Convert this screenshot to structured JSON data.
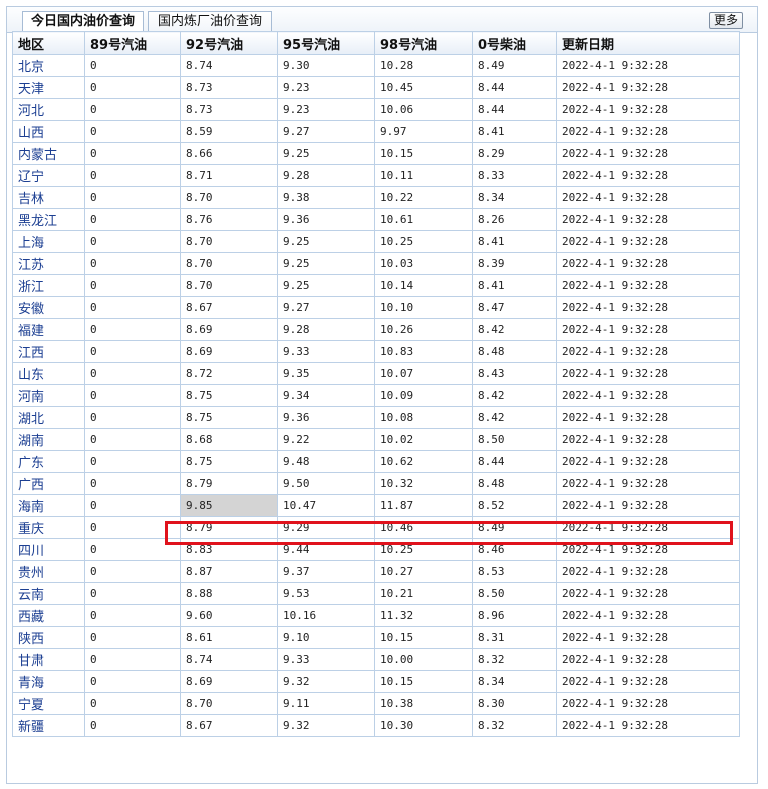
{
  "tabs": [
    {
      "label": "今日国内油价查询",
      "active": true
    },
    {
      "label": "国内炼厂油价查询",
      "active": false
    }
  ],
  "more_label": "更多",
  "columns": [
    "地区",
    "89号汽油",
    "92号汽油",
    "95号汽油",
    "98号汽油",
    "0号柴油",
    "更新日期"
  ],
  "rows": [
    {
      "region": "北京",
      "g89": "0",
      "g92": "8.74",
      "g95": "9.30",
      "g98": "10.28",
      "d0": "8.49",
      "date": "2022-4-1 9:32:28"
    },
    {
      "region": "天津",
      "g89": "0",
      "g92": "8.73",
      "g95": "9.23",
      "g98": "10.45",
      "d0": "8.44",
      "date": "2022-4-1 9:32:28"
    },
    {
      "region": "河北",
      "g89": "0",
      "g92": "8.73",
      "g95": "9.23",
      "g98": "10.06",
      "d0": "8.44",
      "date": "2022-4-1 9:32:28"
    },
    {
      "region": "山西",
      "g89": "0",
      "g92": "8.59",
      "g95": "9.27",
      "g98": "9.97",
      "d0": "8.41",
      "date": "2022-4-1 9:32:28"
    },
    {
      "region": "内蒙古",
      "g89": "0",
      "g92": "8.66",
      "g95": "9.25",
      "g98": "10.15",
      "d0": "8.29",
      "date": "2022-4-1 9:32:28"
    },
    {
      "region": "辽宁",
      "g89": "0",
      "g92": "8.71",
      "g95": "9.28",
      "g98": "10.11",
      "d0": "8.33",
      "date": "2022-4-1 9:32:28"
    },
    {
      "region": "吉林",
      "g89": "0",
      "g92": "8.70",
      "g95": "9.38",
      "g98": "10.22",
      "d0": "8.34",
      "date": "2022-4-1 9:32:28"
    },
    {
      "region": "黑龙江",
      "g89": "0",
      "g92": "8.76",
      "g95": "9.36",
      "g98": "10.61",
      "d0": "8.26",
      "date": "2022-4-1 9:32:28"
    },
    {
      "region": "上海",
      "g89": "0",
      "g92": "8.70",
      "g95": "9.25",
      "g98": "10.25",
      "d0": "8.41",
      "date": "2022-4-1 9:32:28"
    },
    {
      "region": "江苏",
      "g89": "0",
      "g92": "8.70",
      "g95": "9.25",
      "g98": "10.03",
      "d0": "8.39",
      "date": "2022-4-1 9:32:28"
    },
    {
      "region": "浙江",
      "g89": "0",
      "g92": "8.70",
      "g95": "9.25",
      "g98": "10.14",
      "d0": "8.41",
      "date": "2022-4-1 9:32:28"
    },
    {
      "region": "安徽",
      "g89": "0",
      "g92": "8.67",
      "g95": "9.27",
      "g98": "10.10",
      "d0": "8.47",
      "date": "2022-4-1 9:32:28"
    },
    {
      "region": "福建",
      "g89": "0",
      "g92": "8.69",
      "g95": "9.28",
      "g98": "10.26",
      "d0": "8.42",
      "date": "2022-4-1 9:32:28"
    },
    {
      "region": "江西",
      "g89": "0",
      "g92": "8.69",
      "g95": "9.33",
      "g98": "10.83",
      "d0": "8.48",
      "date": "2022-4-1 9:32:28"
    },
    {
      "region": "山东",
      "g89": "0",
      "g92": "8.72",
      "g95": "9.35",
      "g98": "10.07",
      "d0": "8.43",
      "date": "2022-4-1 9:32:28"
    },
    {
      "region": "河南",
      "g89": "0",
      "g92": "8.75",
      "g95": "9.34",
      "g98": "10.09",
      "d0": "8.42",
      "date": "2022-4-1 9:32:28"
    },
    {
      "region": "湖北",
      "g89": "0",
      "g92": "8.75",
      "g95": "9.36",
      "g98": "10.08",
      "d0": "8.42",
      "date": "2022-4-1 9:32:28"
    },
    {
      "region": "湖南",
      "g89": "0",
      "g92": "8.68",
      "g95": "9.22",
      "g98": "10.02",
      "d0": "8.50",
      "date": "2022-4-1 9:32:28"
    },
    {
      "region": "广东",
      "g89": "0",
      "g92": "8.75",
      "g95": "9.48",
      "g98": "10.62",
      "d0": "8.44",
      "date": "2022-4-1 9:32:28"
    },
    {
      "region": "广西",
      "g89": "0",
      "g92": "8.79",
      "g95": "9.50",
      "g98": "10.32",
      "d0": "8.48",
      "date": "2022-4-1 9:32:28"
    },
    {
      "region": "海南",
      "g89": "0",
      "g92": "9.85",
      "g95": "10.47",
      "g98": "11.87",
      "d0": "8.52",
      "date": "2022-4-1 9:32:28",
      "highlighted": true
    },
    {
      "region": "重庆",
      "g89": "0",
      "g92": "8.79",
      "g95": "9.29",
      "g98": "10.46",
      "d0": "8.49",
      "date": "2022-4-1 9:32:28"
    },
    {
      "region": "四川",
      "g89": "0",
      "g92": "8.83",
      "g95": "9.44",
      "g98": "10.25",
      "d0": "8.46",
      "date": "2022-4-1 9:32:28"
    },
    {
      "region": "贵州",
      "g89": "0",
      "g92": "8.87",
      "g95": "9.37",
      "g98": "10.27",
      "d0": "8.53",
      "date": "2022-4-1 9:32:28"
    },
    {
      "region": "云南",
      "g89": "0",
      "g92": "8.88",
      "g95": "9.53",
      "g98": "10.21",
      "d0": "8.50",
      "date": "2022-4-1 9:32:28"
    },
    {
      "region": "西藏",
      "g89": "0",
      "g92": "9.60",
      "g95": "10.16",
      "g98": "11.32",
      "d0": "8.96",
      "date": "2022-4-1 9:32:28"
    },
    {
      "region": "陕西",
      "g89": "0",
      "g92": "8.61",
      "g95": "9.10",
      "g98": "10.15",
      "d0": "8.31",
      "date": "2022-4-1 9:32:28"
    },
    {
      "region": "甘肃",
      "g89": "0",
      "g92": "8.74",
      "g95": "9.33",
      "g98": "10.00",
      "d0": "8.32",
      "date": "2022-4-1 9:32:28"
    },
    {
      "region": "青海",
      "g89": "0",
      "g92": "8.69",
      "g95": "9.32",
      "g98": "10.15",
      "d0": "8.34",
      "date": "2022-4-1 9:32:28"
    },
    {
      "region": "宁夏",
      "g89": "0",
      "g92": "8.70",
      "g95": "9.11",
      "g98": "10.38",
      "d0": "8.30",
      "date": "2022-4-1 9:32:28"
    },
    {
      "region": "新疆",
      "g89": "0",
      "g92": "8.67",
      "g95": "9.32",
      "g98": "10.30",
      "d0": "8.32",
      "date": "2022-4-1 9:32:28"
    }
  ],
  "colors": {
    "highlight_border": "#e0121c",
    "region_link": "#1c3f92",
    "table_border": "#bcd0e6",
    "selection_bg": "#d4d4d4"
  }
}
